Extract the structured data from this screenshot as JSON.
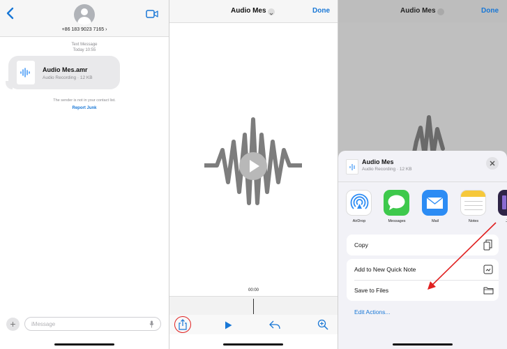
{
  "left_panel": {
    "phone_number": "+86 183 9023 7165 ›",
    "message_type": "Text Message",
    "message_time": "Today 10:55",
    "attachment": {
      "name": "Audio Mes.amr",
      "details": "Audio Recording · 12 KB"
    },
    "notice": "The sender is not in your contact list.",
    "report_link": "Report Junk",
    "input_placeholder": "iMessage"
  },
  "middle_panel": {
    "title": "Audio Mes",
    "done_label": "Done",
    "time": "00:00"
  },
  "right_panel": {
    "title": "Audio Mes",
    "done_label": "Done",
    "sheet": {
      "file_title": "Audio Mes",
      "file_details": "Audio Recording · 12 KB",
      "apps": [
        {
          "label": "AirDrop",
          "icon": "airdrop-icon",
          "color": "#ffffff"
        },
        {
          "label": "Messages",
          "icon": "messages-icon",
          "color": "#3ec94c"
        },
        {
          "label": "Mail",
          "icon": "mail-icon",
          "color": "#2c8cf4"
        },
        {
          "label": "Notes",
          "icon": "notes-icon",
          "color": "#ffffff"
        },
        {
          "label": "Jo",
          "icon": "journal-icon",
          "color": "#2e2446"
        }
      ],
      "actions": {
        "copy": "Copy",
        "quick_note": "Add to New Quick Note",
        "save_files": "Save to Files",
        "edit": "Edit Actions..."
      }
    }
  },
  "colors": {
    "accent": "#1877d6",
    "annotation": "#e02020"
  }
}
